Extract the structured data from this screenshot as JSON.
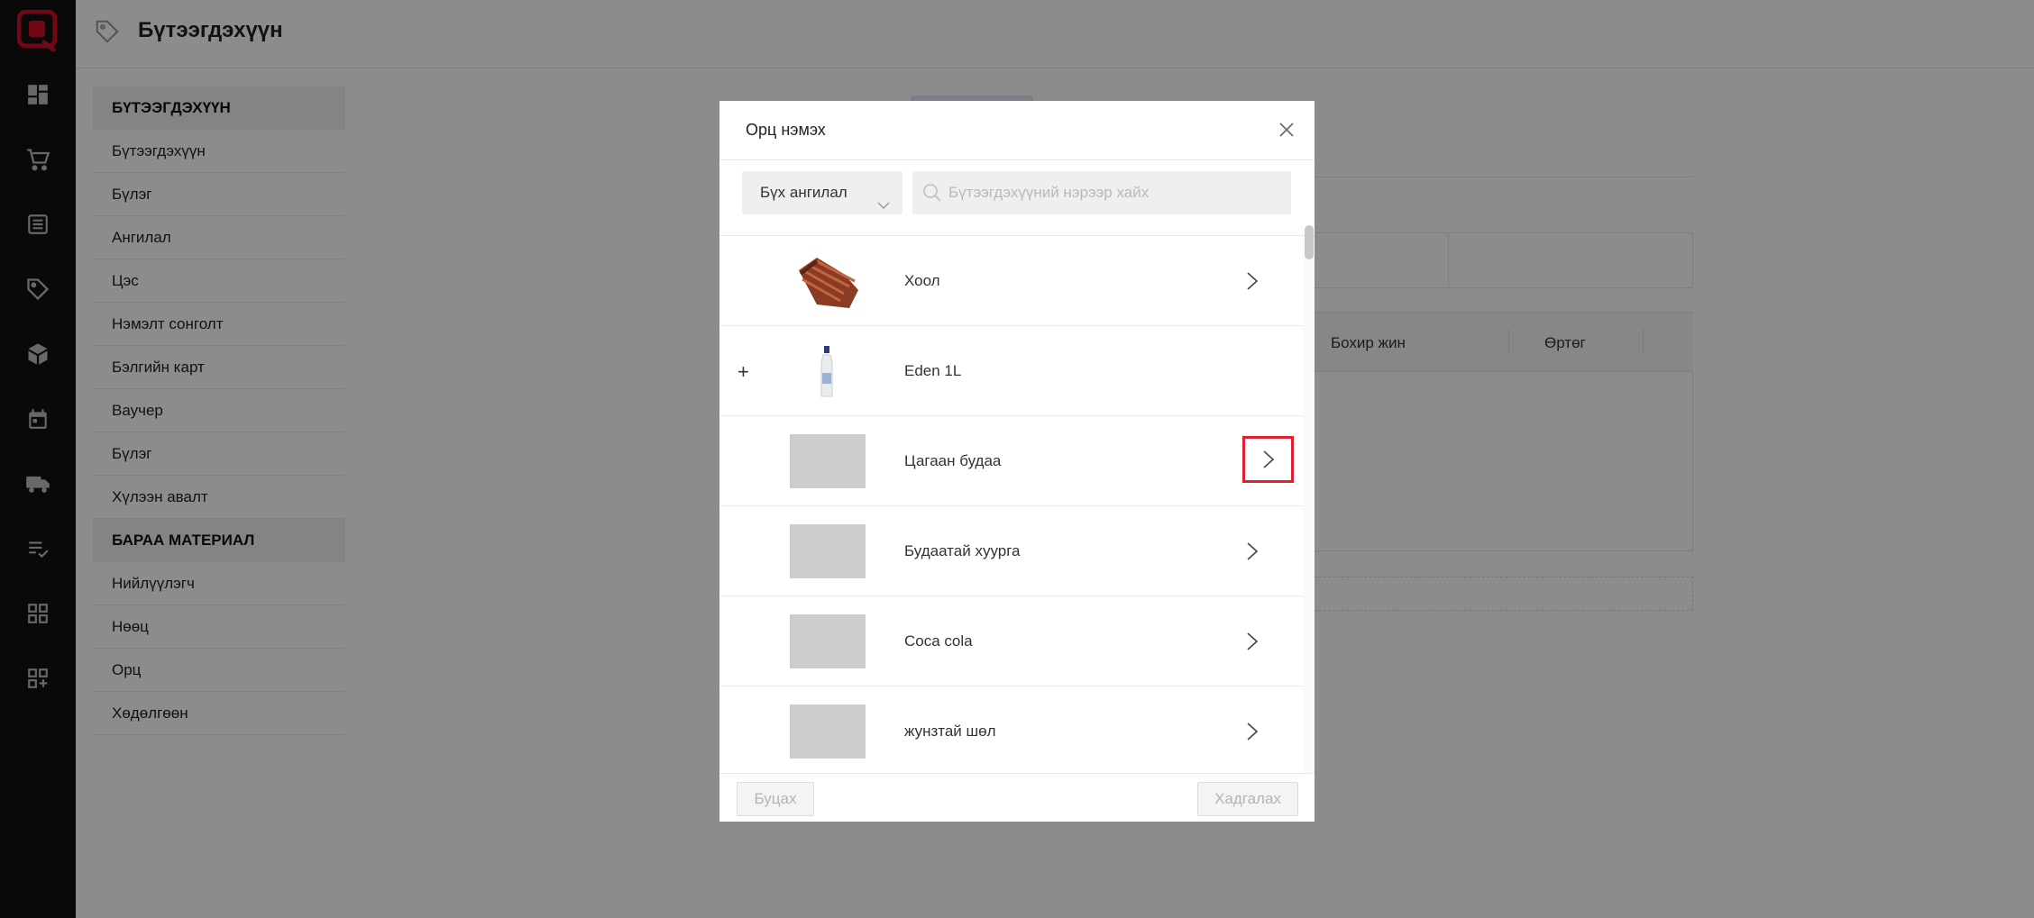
{
  "header": {
    "title": "Бүтээгдэхүүн"
  },
  "rail_icons": [
    "logo-icon",
    "dashboard-icon",
    "cart-icon",
    "list-icon",
    "tag-icon",
    "box-icon",
    "calendar-icon",
    "truck-icon",
    "checklist-icon",
    "grid-icon",
    "add-grid-icon"
  ],
  "sidebar": {
    "section1": "БҮТЭЭГДЭХҮҮН",
    "items1": [
      "Бүтээгдэхүүн",
      "Бүлэг",
      "Ангилал",
      "Цэс",
      "Нэмэлт сонголт",
      "Бэлгийн карт",
      "Ваучер",
      "Бүлэг",
      "Хүлээн авалт"
    ],
    "section2": "БАРАА МАТЕРИАЛ",
    "items2": [
      "Нийлүүлэгч",
      "Нөөц",
      "Орц",
      "Хөдөлгөөн"
    ]
  },
  "background_table": {
    "col1": "Бохир жин",
    "col2": "Өртөг"
  },
  "modal": {
    "title": "Орц нэмэх",
    "category_select": "Бүх ангилал",
    "search_placeholder": "Бүтээгдэхүүний нэрээр хайх",
    "items": [
      {
        "name": "Хоол",
        "has_arrow": true,
        "has_plus": false,
        "thumb": "meat"
      },
      {
        "name": "Eden 1L",
        "has_arrow": false,
        "has_plus": true,
        "thumb": "bottle"
      },
      {
        "name": "Цагаан будаа",
        "has_arrow": true,
        "has_plus": false,
        "thumb": "placeholder",
        "highlighted": true
      },
      {
        "name": "Будаатай хуурга",
        "has_arrow": true,
        "has_plus": false,
        "thumb": "placeholder"
      },
      {
        "name": "Coca cola",
        "has_arrow": true,
        "has_plus": false,
        "thumb": "placeholder"
      },
      {
        "name": "жунзтай шөл",
        "has_arrow": true,
        "has_plus": false,
        "thumb": "placeholder"
      }
    ],
    "plus_symbol": "+",
    "back_button": "Буцах",
    "save_button": "Хадгалах"
  },
  "colors": {
    "rail": "#111111",
    "accent": "#e0202e",
    "overlay": "rgba(0,0,0,0.45)"
  }
}
